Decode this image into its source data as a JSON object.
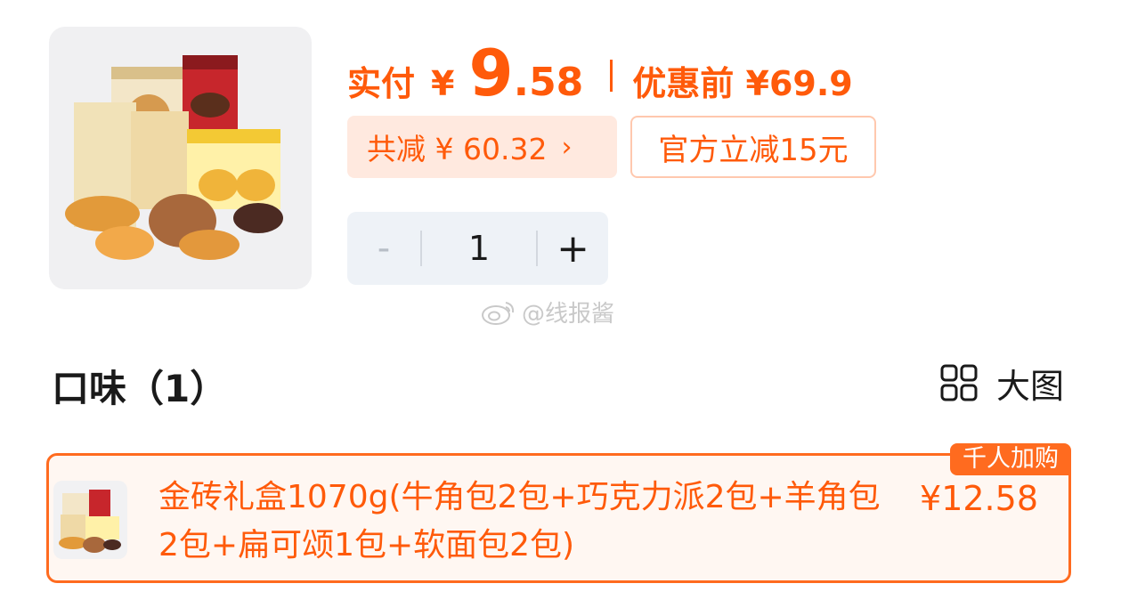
{
  "price": {
    "paid_label": "实付",
    "currency": "¥",
    "int": "9",
    "dot": ".",
    "dec": "58",
    "original": "优惠前 ¥69.9"
  },
  "discount": {
    "total_label": "共减 ¥ 60.32",
    "chevron": "›",
    "official": "官方立减15元"
  },
  "quantity": {
    "minus": "-",
    "value": "1",
    "plus": "+"
  },
  "watermark": {
    "text": "@线报酱"
  },
  "flavor": {
    "title": "口味（1）",
    "view_label": "大图"
  },
  "sku": {
    "name": "金砖礼盒1070g(牛角包2包+巧克力派2包+羊角包2包+扁可颂1包+软面包2包)",
    "price": "¥12.58",
    "badge": "千人加购"
  },
  "colors": {
    "accent": "#ff5a0a",
    "chip_bg": "#ffe9df",
    "stepper_bg": "#eef2f7",
    "card_bg": "#fff7f2"
  },
  "icons": [
    "grid-icon",
    "weibo-icon",
    "chevron-right-icon"
  ]
}
